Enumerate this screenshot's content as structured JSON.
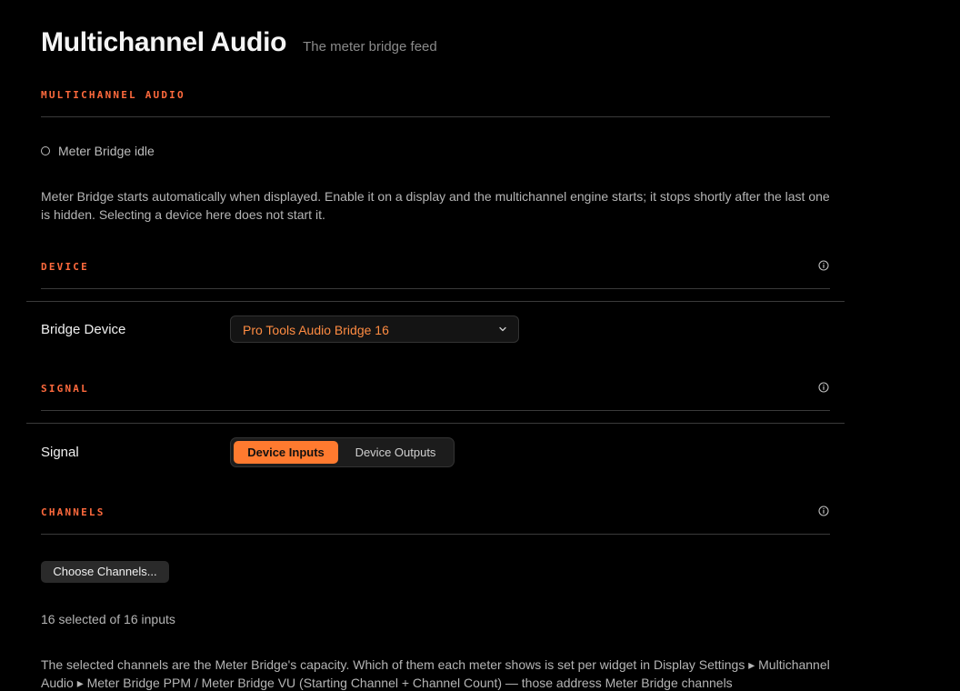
{
  "header": {
    "title": "Multichannel Audio",
    "subtitle": "The meter bridge feed"
  },
  "colors": {
    "accent": "#ff7a2f",
    "section_label": "#ff6a3d",
    "background": "#000000"
  },
  "sections": {
    "multichannel": {
      "label": "MULTICHANNEL AUDIO"
    },
    "device": {
      "label": "DEVICE",
      "icon": "info-icon"
    },
    "signal": {
      "label": "SIGNAL",
      "icon": "info-icon"
    },
    "channels": {
      "label": "CHANNELS",
      "icon": "info-icon"
    }
  },
  "status": {
    "icon": "empty-circle-icon",
    "text": "Meter Bridge idle"
  },
  "descriptions": {
    "auto_start": "Meter Bridge starts automatically when displayed. Enable it on a display and the multichannel engine starts; it stops shortly after the last one is hidden. Selecting a device here does not start it.",
    "capacity": "The selected channels are the Meter Bridge's capacity. Which of them each meter shows is set per widget in Display Settings ▸ Multichannel Audio ▸ Meter Bridge PPM / Meter Bridge VU (Starting Channel + Channel Count) — those address Meter Bridge channels"
  },
  "bridge_device": {
    "label": "Bridge Device",
    "selected": "Pro Tools Audio Bridge 16",
    "icon": "chevron-down-icon"
  },
  "signal": {
    "label": "Signal",
    "options": [
      "Device Inputs",
      "Device Outputs"
    ],
    "selected": "Device Inputs"
  },
  "channels": {
    "button_label": "Choose Channels...",
    "count_text": "16 selected of 16 inputs"
  }
}
